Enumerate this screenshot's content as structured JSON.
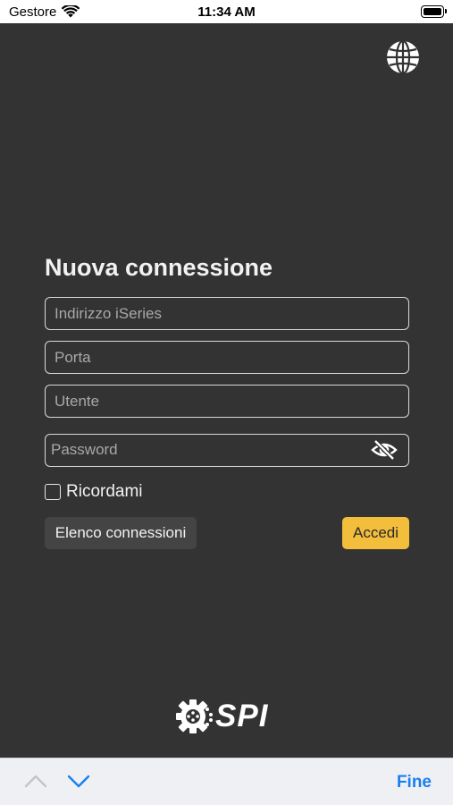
{
  "status_bar": {
    "carrier": "Gestore",
    "time": "11:34 AM",
    "wifi_icon": "wifi-icon",
    "battery_icon": "battery-full-icon"
  },
  "header": {
    "language_icon": "globe-icon"
  },
  "login": {
    "title": "Nuova connessione",
    "server_placeholder": "Indirizzo iSeries",
    "server_value": "",
    "port_placeholder": "Porta",
    "port_value": "",
    "user_placeholder": "Utente",
    "user_value": "",
    "password_placeholder": "Password",
    "password_value": "",
    "password_toggle_icon": "eye-slash-icon",
    "remember_label": "Ricordami",
    "remember_checked": false,
    "connections_button": "Elenco connessioni",
    "login_button": "Accedi"
  },
  "brand": {
    "logo_text": "SPI",
    "logo_icon": "gear-icon"
  },
  "keyboard_accessory": {
    "prev_icon": "chevron-up-icon",
    "next_icon": "chevron-down-icon",
    "done_label": "Fine"
  },
  "colors": {
    "background": "#333333",
    "accent": "#f2be3c",
    "secondary_button": "#444444",
    "link_blue": "#1a7ff0"
  }
}
